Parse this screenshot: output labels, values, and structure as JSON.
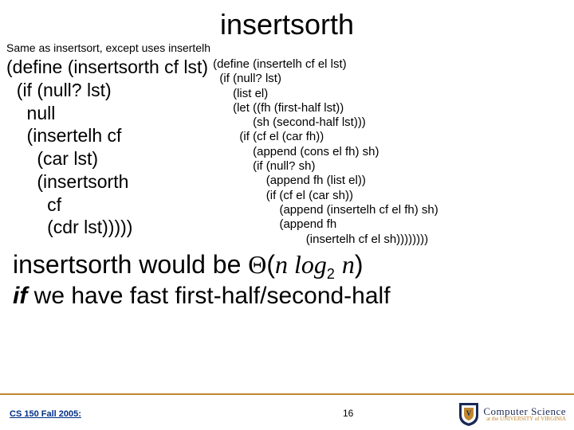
{
  "title": "insertsorth",
  "subtitle": "Same as insertsort, except uses insertelh",
  "left_code": "(define (insertsorth cf lst)\n  (if (null? lst)\n    null\n    (insertelh cf\n      (car lst)\n      (insertsorth\n        cf\n        (cdr lst)))))",
  "right_code": "(define (insertelh cf el lst)\n  (if (null? lst)\n      (list el)\n      (let ((fh (first-half lst))\n            (sh (second-half lst)))\n        (if (cf el (car fh))\n            (append (cons el fh) sh)\n            (if (null? sh)\n                (append fh (list el))\n                (if (cf el (car sh))\n                    (append (insertelh cf el fh) sh)\n                    (append fh\n                            (insertelh cf el sh))))))))",
  "complexity": {
    "line1_prefix": "insertsorth would be ",
    "theta": "Θ",
    "expr_open": "(",
    "n": "n",
    "log": " log",
    "base": "2",
    "space": " ",
    "expr_close": ")",
    "line2_if": "if",
    "line2_rest": " we have fast first-half/second-half"
  },
  "footer": {
    "course": "CS 150 Fall 2005:",
    "page": "16"
  },
  "logo": {
    "main": "Computer Science",
    "sub": "at the UNIVERSITY of VIRGINIA"
  }
}
